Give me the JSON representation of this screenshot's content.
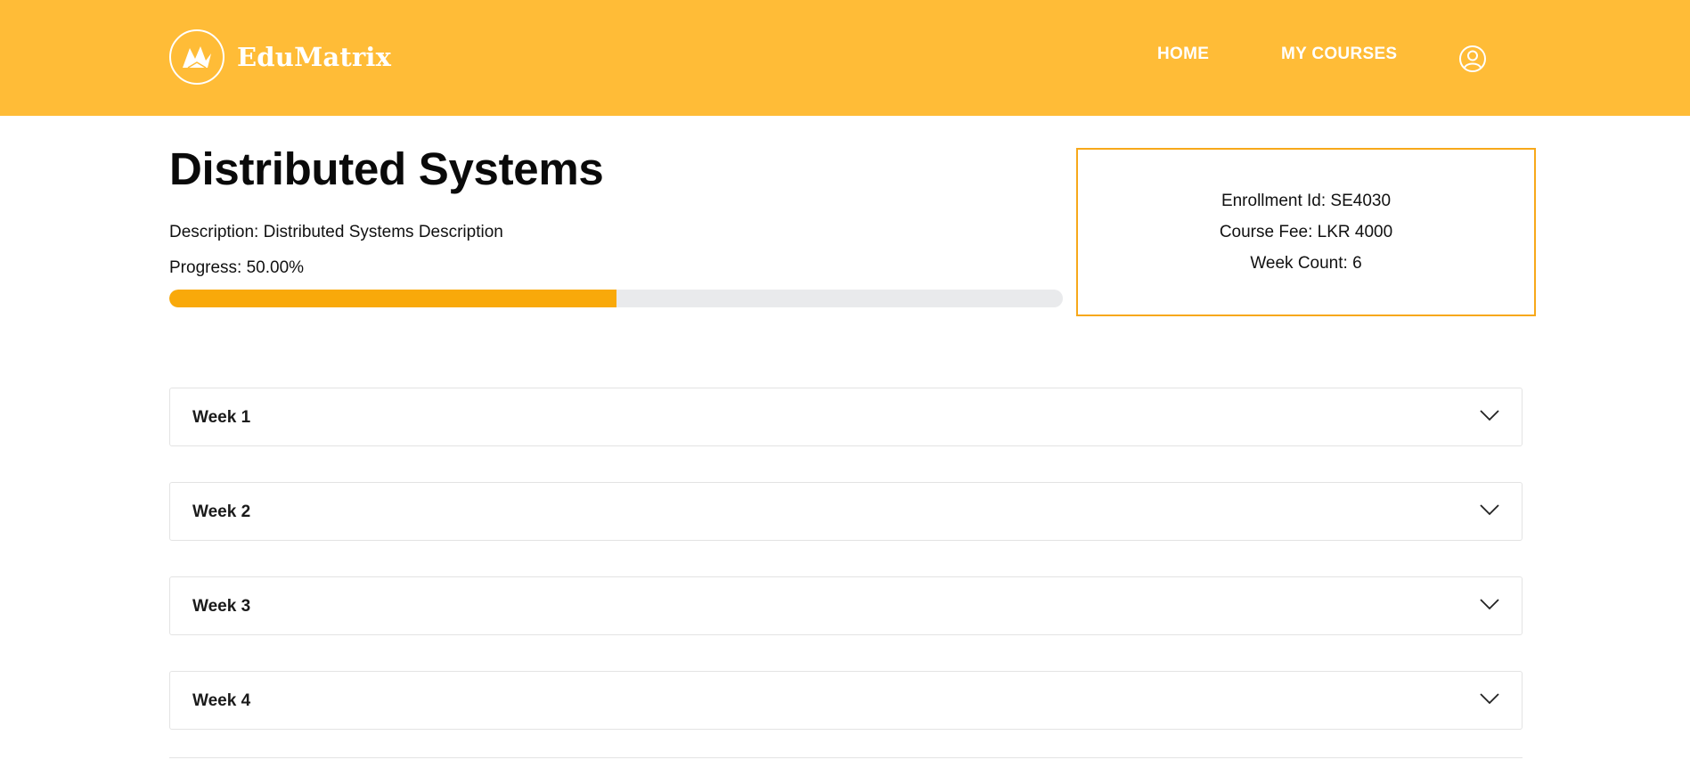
{
  "brand": {
    "name": "EduMatrix",
    "logo_icon": "crane-logo-icon"
  },
  "nav": {
    "home_label": "HOME",
    "courses_label": "MY COURSES",
    "user_icon": "user-circle-icon"
  },
  "course": {
    "title": "Distributed Systems",
    "description": "Description: Distributed Systems Description",
    "progress_label": "Progress: 50.00%",
    "progress_fraction": 0.5
  },
  "info": {
    "enrollment": "Enrollment Id: SE4030",
    "fee": "Course Fee: LKR 4000",
    "week_count": "Week Count: 6"
  },
  "weeks": [
    {
      "label": "Week 1"
    },
    {
      "label": "Week 2"
    },
    {
      "label": "Week 3"
    },
    {
      "label": "Week 4"
    }
  ],
  "colors": {
    "header": "#FFBC37",
    "accent": "#F9A90A",
    "track": "#E9EAEC",
    "border": "#F7A81A"
  }
}
